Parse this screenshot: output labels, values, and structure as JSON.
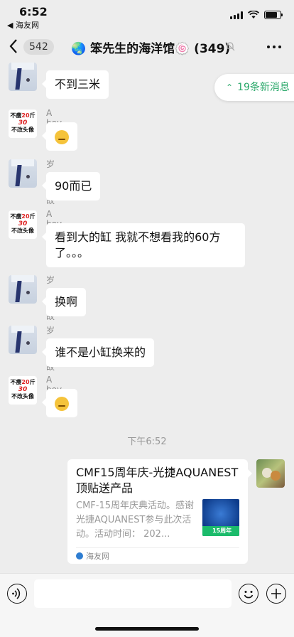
{
  "status": {
    "time": "6:52",
    "back_app": "◀ 海友网"
  },
  "nav": {
    "unread_count": "542",
    "title": "🌏 笨先生的海洋馆🍥 (349)"
  },
  "new_messages": {
    "label": "19条新消息",
    "color": "#2aa86a"
  },
  "messages": [
    {
      "sender": "岁月如故",
      "text": "不到三米",
      "avatar": "shirt"
    },
    {
      "sender": "A boy",
      "text": "😅",
      "avatar": "boy"
    },
    {
      "sender": "岁月如故",
      "text": "90而已",
      "avatar": "shirt"
    },
    {
      "sender": "A boy",
      "text_line1": "看到大的缸  我就不想看我的60方",
      "text_line2": "了。。。",
      "avatar": "boy"
    },
    {
      "sender": "岁月如故",
      "text": "换啊",
      "avatar": "shirt"
    },
    {
      "sender": "岁月如故",
      "text": "谁不是小缸换来的",
      "avatar": "shirt"
    },
    {
      "sender": "A boy",
      "text": "😙",
      "avatar": "boy"
    }
  ],
  "boy_avatar": {
    "line1a": "不瘦",
    "line1b": "20",
    "line1c": "斤",
    "line2": "30",
    "line3": "不改头像"
  },
  "timestamp": "下午6:52",
  "card": {
    "title": "CMF15周年庆-光捷AQUANEST顶贴送产品",
    "description": "CMF-15周年庆典活动。感谢光捷AQUANEST参与此次活动。活动时间： 202...",
    "source": "海友网",
    "thumb_text": "15周年"
  }
}
